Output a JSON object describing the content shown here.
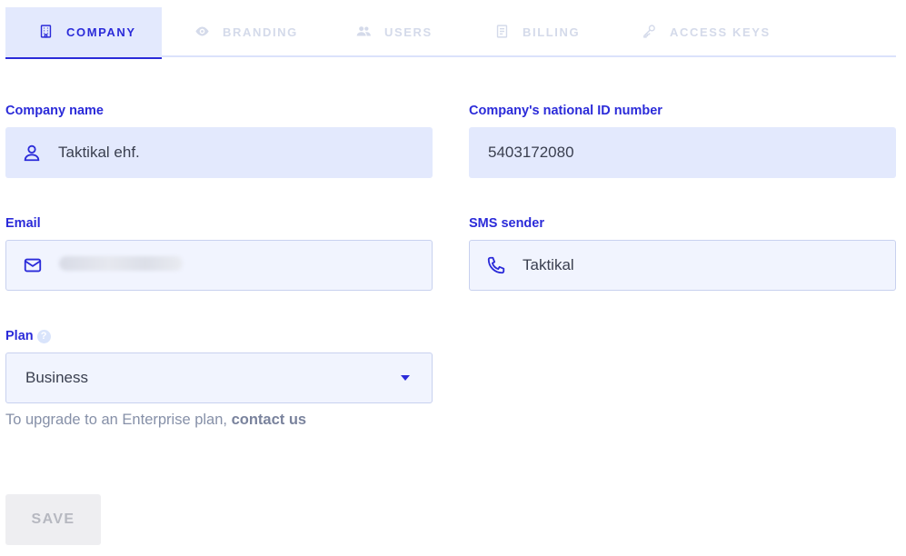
{
  "tabs": [
    {
      "label": "COMPANY",
      "icon": "building-icon",
      "active": true
    },
    {
      "label": "BRANDING",
      "icon": "eye-icon",
      "active": false
    },
    {
      "label": "USERS",
      "icon": "users-icon",
      "active": false
    },
    {
      "label": "BILLING",
      "icon": "document-icon",
      "active": false
    },
    {
      "label": "ACCESS KEYS",
      "icon": "key-icon",
      "active": false
    }
  ],
  "form": {
    "company_name": {
      "label": "Company name",
      "value": "Taktikal ehf.",
      "icon": "person-icon"
    },
    "national_id": {
      "label": "Company's national ID number",
      "value": "5403172080"
    },
    "email": {
      "label": "Email",
      "value": "",
      "icon": "mail-icon"
    },
    "sms_sender": {
      "label": "SMS sender",
      "value": "Taktikal",
      "icon": "phone-icon"
    },
    "plan": {
      "label": "Plan",
      "help": "?",
      "value": "Business"
    },
    "upgrade_hint": {
      "text": "To upgrade to an Enterprise plan,",
      "link": "contact us"
    }
  },
  "actions": {
    "save_label": "SAVE"
  },
  "colors": {
    "accent": "#2b2bd9",
    "field_fill": "#e3e9fd",
    "muted_tab": "#d4daea"
  }
}
